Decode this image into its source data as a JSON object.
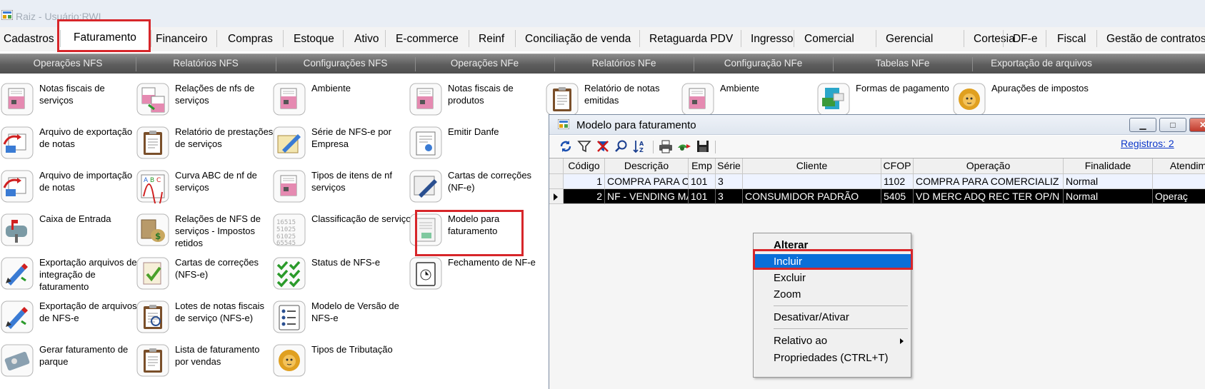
{
  "window": {
    "title": "Raiz - Usuário:RWI"
  },
  "menu": {
    "items": [
      {
        "label": "Cadastros",
        "active": false
      },
      {
        "label": "Faturamento",
        "active": true
      },
      {
        "label": "Financeiro",
        "active": false
      },
      {
        "label": "Compras",
        "active": false
      },
      {
        "label": "Estoque",
        "active": false
      },
      {
        "label": "Ativo",
        "active": false
      },
      {
        "label": "E-commerce",
        "active": false
      },
      {
        "label": "Reinf",
        "active": false
      },
      {
        "label": "Conciliação de venda",
        "active": false
      },
      {
        "label": "Retaguarda PDV",
        "active": false
      },
      {
        "label": "Ingresso",
        "active": false
      },
      {
        "label": "Comercial",
        "active": false
      },
      {
        "label": "Gerencial",
        "active": false
      },
      {
        "label": "Cortesia",
        "active": false
      },
      {
        "label": "DF-e",
        "active": false
      },
      {
        "label": "Fiscal",
        "active": false
      },
      {
        "label": "Gestão de contratos",
        "active": false
      }
    ]
  },
  "subbar": {
    "items": [
      "Operações NFS",
      "Relatórios NFS",
      "Configurações NFS",
      "Operações NFe",
      "Relatórios NFe",
      "Configuração NFe",
      "Tabelas NFe",
      "Exportação de arquivos"
    ]
  },
  "tiles": [
    {
      "label": "Notas fiscais de serviços",
      "icon": "document-pink-icon"
    },
    {
      "label": "Arquivo de exportação de notas",
      "icon": "export-arrow-icon"
    },
    {
      "label": "Arquivo de importação de notas",
      "icon": "import-arrow-icon"
    },
    {
      "label": "Caixa de Entrada",
      "icon": "mailbox-icon"
    },
    {
      "label": "Exportação arquivos de integração de faturamento",
      "icon": "export-pen-icon"
    },
    {
      "label": "Exportação de arquivos de NFS-e",
      "icon": "export-pen-icon"
    },
    {
      "label": "Gerar faturamento de parque",
      "icon": "ticket-icon"
    },
    {
      "label": "Relações de nfs de serviços",
      "icon": "document-relation-icon"
    },
    {
      "label": "Relatório de prestações de serviços",
      "icon": "clipboard-icon"
    },
    {
      "label": "Curva ABC de nf de serviços",
      "icon": "abc-curve-icon"
    },
    {
      "label": "Relações de NFS de serviços - Impostos retidos",
      "icon": "money-bag-icon"
    },
    {
      "label": "Cartas de correções (NFS-e)",
      "icon": "check-document-icon"
    },
    {
      "label": "Lotes de notas fiscais de serviço (NFS-e)",
      "icon": "clipboard-search-icon"
    },
    {
      "label": "Lista de faturamento por vendas",
      "icon": "clipboard-icon"
    },
    {
      "label": "Ambiente",
      "icon": "monitor-icon"
    },
    {
      "label": "Série de NFS-e por Empresa",
      "icon": "notepad-pen-icon"
    },
    {
      "label": "Tipos de itens de nf serviços",
      "icon": "document-pink-icon"
    },
    {
      "label": "Classificação de serviço",
      "icon": "numbers-icon"
    },
    {
      "label": "Status de NFS-e",
      "icon": "checkmarks-icon"
    },
    {
      "label": "Modelo de Versão de NFS-e",
      "icon": "list-icon"
    },
    {
      "label": "Tipos de Tributação",
      "icon": "lion-icon"
    },
    {
      "label": "Notas fiscais de produtos",
      "icon": "document-pink-icon"
    },
    {
      "label": "Emitir Danfe",
      "icon": "danfe-icon"
    },
    {
      "label": "Cartas de correções (NF-e)",
      "icon": "letter-pen-icon"
    },
    {
      "label": "Modelo para faturamento",
      "icon": "template-document-icon"
    },
    {
      "label": "Fechamento de NF-e",
      "icon": "clipboard-clock-icon"
    },
    {
      "label": "Relatório de notas emitidas",
      "icon": "clipboard-icon"
    },
    {
      "label": "Ambiente",
      "icon": "monitor-icon"
    },
    {
      "label": "Formas de pagamento",
      "icon": "payment-icon"
    },
    {
      "label": "Apurações de impostos",
      "icon": "lion-icon"
    }
  ],
  "dialog": {
    "title": "Modelo para faturamento",
    "registros": "Registros: 2",
    "columns": [
      "Código",
      "Descrição",
      "Emp",
      "Série",
      "Cliente",
      "CFOP",
      "Operação",
      "Finalidade",
      "Atendim"
    ],
    "rows": [
      {
        "codigo": "1",
        "descricao": "COMPRA PARA C",
        "emp": "101",
        "serie": "3",
        "cliente": "",
        "cfop": "1102",
        "operacao": "COMPRA PARA COMERCIALIZ",
        "finalidade": "Normal",
        "atendimento": ""
      },
      {
        "codigo": "2",
        "descricao": "NF - VENDING MA",
        "emp": "101",
        "serie": "3",
        "cliente": "CONSUMIDOR PADRÃO",
        "cfop": "5405",
        "operacao": "VD MERC ADQ REC TER OP/N",
        "finalidade": "Normal",
        "atendimento": "Operaç"
      }
    ]
  },
  "context_menu": {
    "items": [
      "Alterar",
      "Incluir",
      "Excluir",
      "Zoom",
      "Desativar/Ativar",
      "Relativo ao",
      "Propriedades (CTRL+T)"
    ],
    "selected": "Incluir"
  },
  "colors": {
    "highlight": "#d7262a",
    "selection": "#0a6fd8",
    "link": "#0b36c9"
  }
}
